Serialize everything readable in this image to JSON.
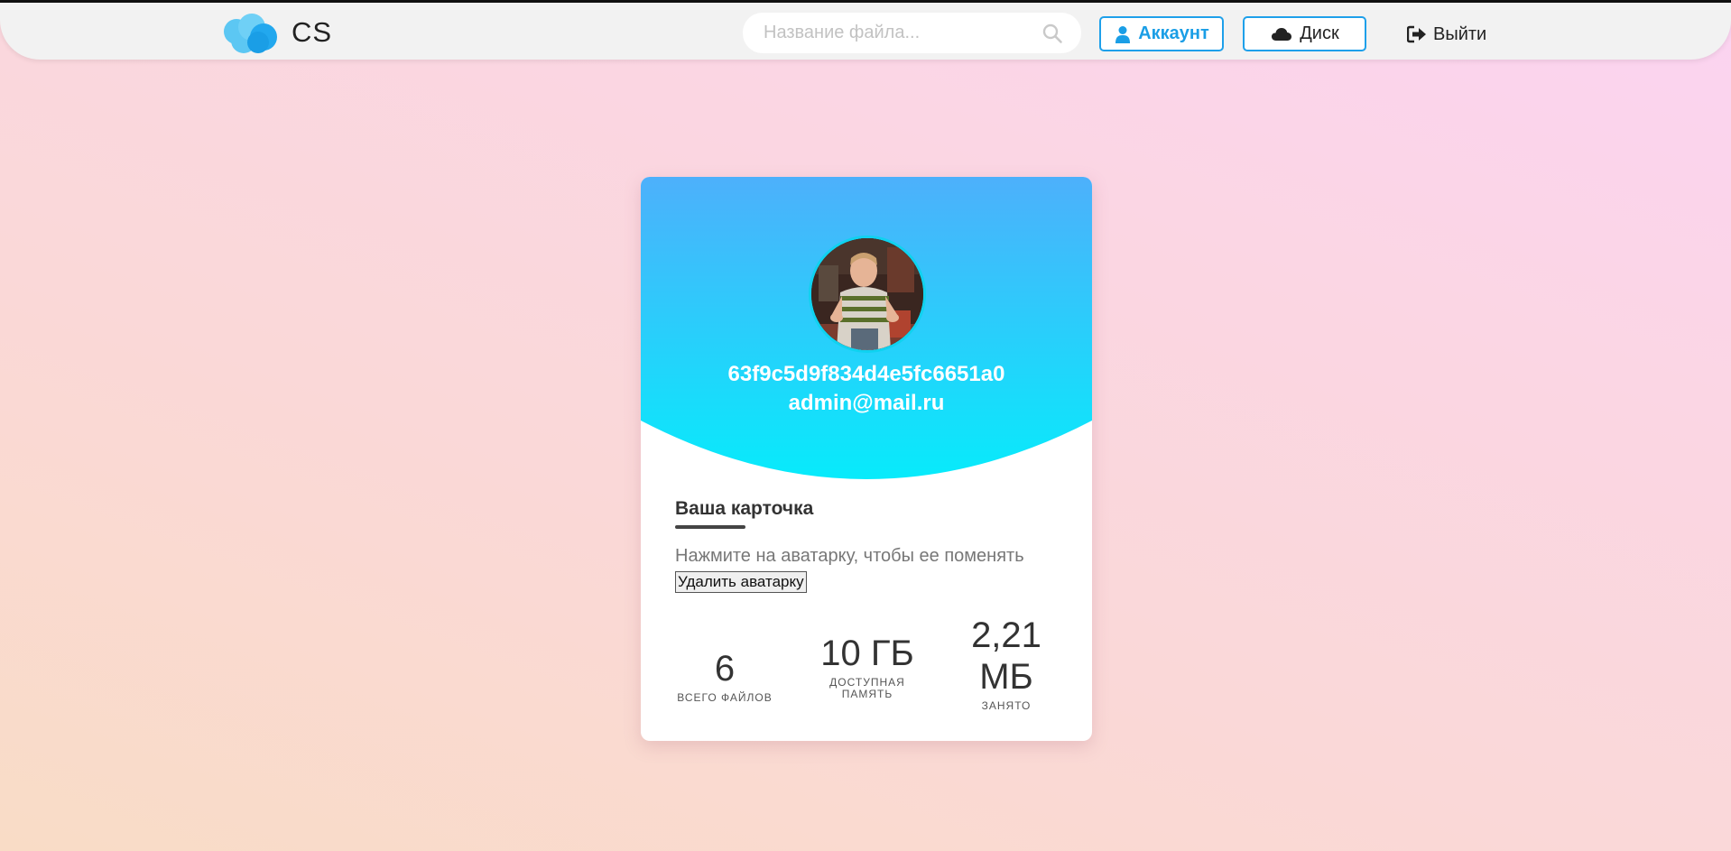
{
  "header": {
    "brand": "CS",
    "search": {
      "placeholder": "Название файла...",
      "value": ""
    },
    "account_label": "Аккаунт",
    "disk_label": "Диск",
    "logout_label": "Выйти"
  },
  "icons": {
    "logo": "cloud-logo-icon",
    "search": "search-icon",
    "account": "user-icon",
    "disk": "cloud-icon",
    "logout": "sign-out-icon"
  },
  "colors": {
    "accent": "#1a9ee6",
    "card_gradient_top": "#4db0fb",
    "card_gradient_bottom": "#07ebfb"
  },
  "card": {
    "user_id": "63f9c5d9f834d4e5fc6651a0",
    "email": "admin@mail.ru",
    "title": "Ваша карточка",
    "hint": "Нажмите на аватарку, чтобы ее поменять",
    "delete_avatar_label": "Удалить аватарку",
    "stats": [
      {
        "value": "6",
        "label": "ВСЕГО ФАЙЛОВ"
      },
      {
        "value": "10 ГБ",
        "label": "ДОСТУПНАЯ ПАМЯТЬ"
      },
      {
        "value": "2,21 МБ",
        "label": "ЗАНЯТО"
      }
    ]
  }
}
